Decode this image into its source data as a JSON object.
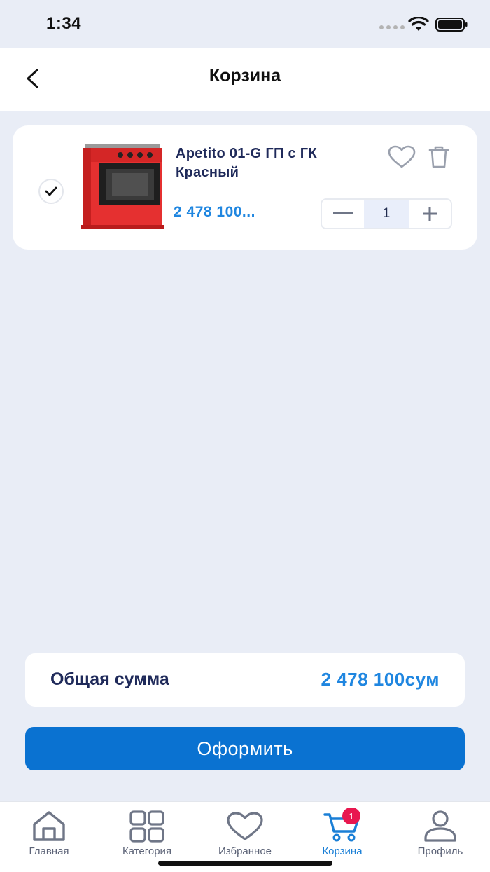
{
  "status_bar": {
    "time": "1:34"
  },
  "header": {
    "title": "Корзина"
  },
  "cart": {
    "items": [
      {
        "title": "Apetito 01-G ГП с ГК Красный",
        "price": "2 478 100...",
        "quantity": "1",
        "selected": true
      }
    ]
  },
  "summary": {
    "label": "Общая сумма",
    "value": "2 478 100сум"
  },
  "checkout": {
    "label": "Оформить"
  },
  "tabs": [
    {
      "label": "Главная",
      "icon": "home-icon",
      "active": false
    },
    {
      "label": "Категория",
      "icon": "grid-icon",
      "active": false
    },
    {
      "label": "Избранное",
      "icon": "heart-icon",
      "active": false
    },
    {
      "label": "Корзина",
      "icon": "cart-icon",
      "active": true,
      "badge": "1"
    },
    {
      "label": "Профиль",
      "icon": "user-icon",
      "active": false
    }
  ],
  "colors": {
    "accent": "#0a72d1",
    "price": "#1f86e0",
    "badge": "#e8174f",
    "background": "#e9edf6"
  }
}
